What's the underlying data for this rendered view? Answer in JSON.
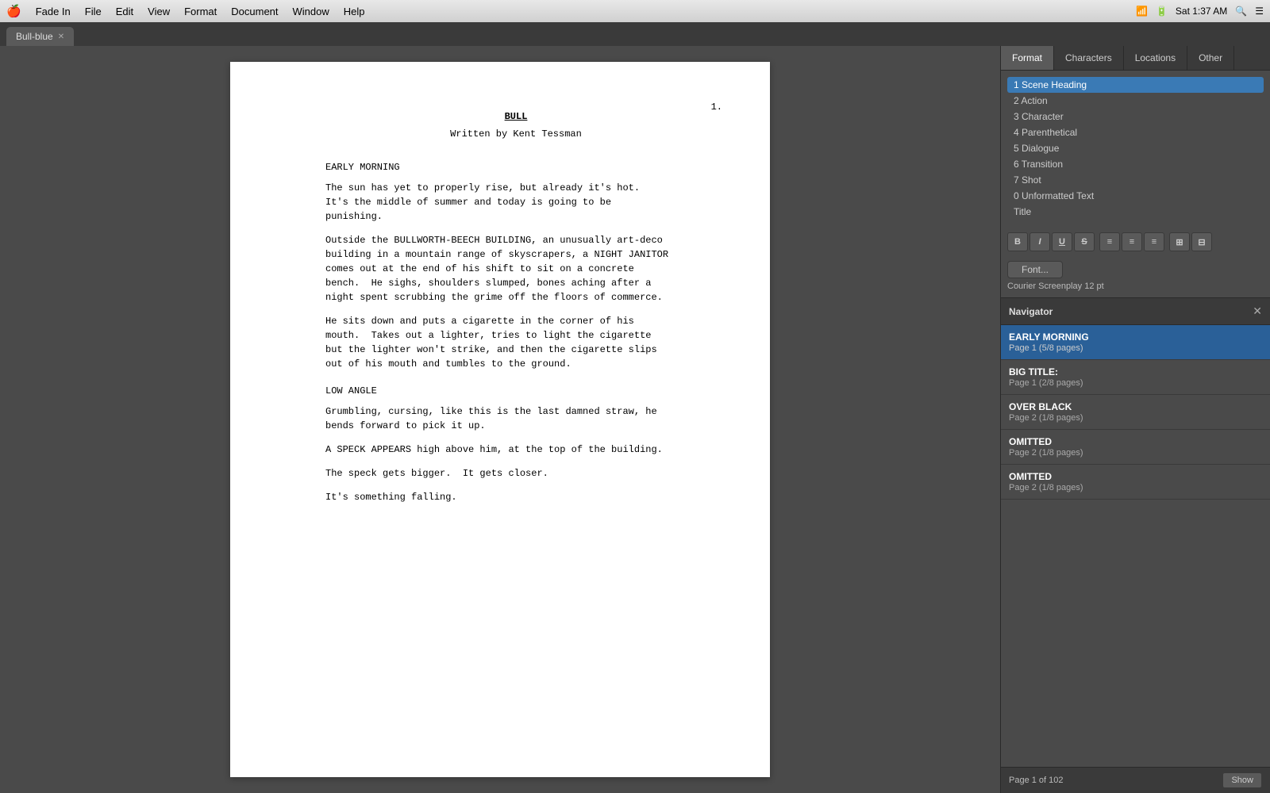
{
  "menubar": {
    "apple": "🍎",
    "items": [
      "Fade In",
      "File",
      "Edit",
      "View",
      "Format",
      "Document",
      "Window",
      "Help"
    ],
    "right": {
      "wifi": "WiFi",
      "battery": "🔋",
      "time": "Sat 1:37 AM",
      "search": "🔍",
      "list": "☰"
    }
  },
  "tab": {
    "label": "Bull-blue",
    "close": "✕"
  },
  "panel_tabs": {
    "tabs": [
      "Format",
      "Characters",
      "Locations",
      "Other"
    ],
    "active": "Format"
  },
  "format_list": {
    "items": [
      {
        "id": 1,
        "label": "1 Scene Heading",
        "selected": true
      },
      {
        "id": 2,
        "label": "2 Action"
      },
      {
        "id": 3,
        "label": "3 Character"
      },
      {
        "id": 4,
        "label": "4 Parenthetical"
      },
      {
        "id": 5,
        "label": "5 Dialogue"
      },
      {
        "id": 6,
        "label": "6 Transition"
      },
      {
        "id": 7,
        "label": "7 Shot"
      },
      {
        "id": 8,
        "label": "0 Unformatted Text"
      },
      {
        "id": 9,
        "label": "Title"
      }
    ]
  },
  "format_toolbar": {
    "buttons": [
      "B",
      "I",
      "U",
      "S",
      "≡",
      "≡",
      "≡",
      "⊞",
      "⊟"
    ]
  },
  "font_section": {
    "button_label": "Font...",
    "font_info": "Courier Screenplay 12 pt"
  },
  "navigator": {
    "title": "Navigator",
    "items": [
      {
        "title": "EARLY MORNING",
        "sub": "Page 1 (5/8 pages)",
        "active": true
      },
      {
        "title": "BIG TITLE:",
        "sub": "Page 1 (2/8 pages)"
      },
      {
        "title": "OVER BLACK",
        "sub": "Page 2 (1/8 pages)"
      },
      {
        "title": "OMITTED",
        "sub": "Page 2 (1/8 pages)"
      },
      {
        "title": "OMITTED",
        "sub": "Page 2 (1/8 pages)"
      }
    ],
    "footer": {
      "page_info": "Page 1 of 102",
      "show_label": "Show"
    }
  },
  "script": {
    "page_number": "1.",
    "title": "BULL",
    "byline": "Written by Kent Tessman",
    "content": [
      {
        "type": "shot",
        "text": "EARLY MORNING"
      },
      {
        "type": "action",
        "text": "The sun has yet to properly rise, but already it's hot.\nIt's the middle of summer and today is going to be\npunishing."
      },
      {
        "type": "action",
        "text": "Outside the BULLWORTH-BEECH BUILDING, an unusually art-deco\nbuilding in a mountain range of skyscrapers, a NIGHT JANITOR\ncomes out at the end of his shift to sit on a concrete\nbench.  He sighs, shoulders slumped, bones aching after a\nnight spent scrubbing the grime off the floors of commerce."
      },
      {
        "type": "action",
        "text": "He sits down and puts a cigarette in the corner of his\nmouth.  Takes out a lighter, tries to light the cigarette\nbut the lighter won't strike, and then the cigarette slips\nout of his mouth and tumbles to the ground."
      },
      {
        "type": "shot",
        "text": "LOW ANGLE"
      },
      {
        "type": "action",
        "text": "Grumbling, cursing, like this is the last damned straw, he\nbends forward to pick it up."
      },
      {
        "type": "action",
        "text": "A SPECK APPEARS high above him, at the top of the building."
      },
      {
        "type": "action",
        "text": "The speck gets bigger.  It gets closer."
      },
      {
        "type": "action",
        "text": "It's something falling."
      }
    ]
  }
}
